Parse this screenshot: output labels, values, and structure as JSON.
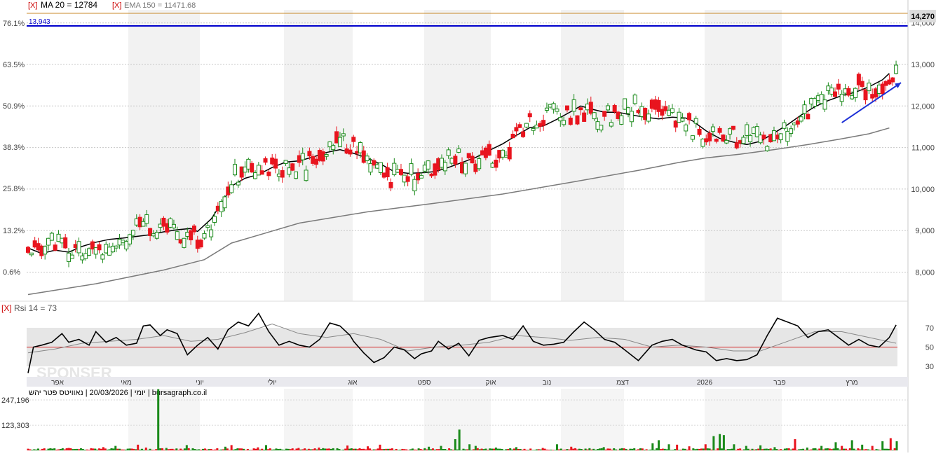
{
  "header": {
    "ma_toggle": "[X]",
    "ma_label": "MA 20 = 12784",
    "ema_toggle": "[X]",
    "ema_label": "EMA 150 = 11471.68",
    "rsi_toggle": "[X]",
    "rsi_label": "Rsi 14 = 73",
    "footer_label": "יומי | 20/03/2026 | נאוויטס פטר יהש | bursagraph.co.il",
    "watermark": "SPONSER"
  },
  "colors": {
    "up": "#1a8a1a",
    "down": "#e8141e",
    "ma": "#000000",
    "ema": "#7a7a7a",
    "resistance": "#0000cc",
    "price_line": "#c88a2a",
    "trend_arrow": "#1c2fd6",
    "band_shade": "#e6e6e6",
    "rsi_mid": "#d42020"
  },
  "chart_data": [
    {
      "type": "candlestick",
      "y_axis_ticks": [
        "14,000",
        "13,000",
        "12,000",
        "11,000",
        "10,000",
        "9,000",
        "8,000"
      ],
      "left_axis_ticks": [
        "76.1%",
        "63.5%",
        "50.9%",
        "38.3%",
        "25.8%",
        "13.2%",
        "0.6%"
      ],
      "last_price_label": "14,270",
      "last_price": 14270,
      "resistance_label": "13,943",
      "resistance": 13943,
      "ylim": [
        7400,
        14400
      ],
      "x_month_labels": [
        "אפר",
        "מאי",
        "יוני",
        "יולי",
        "אוג",
        "ספט",
        "אוק",
        "נוב",
        "דצמ",
        "2026",
        "פבר",
        "מרץ"
      ],
      "series": [
        {
          "name": "MA 20",
          "points": [
            [
              0,
              8580
            ],
            [
              20,
              8450
            ],
            [
              40,
              8530
            ],
            [
              60,
              8480
            ],
            [
              80,
              8620
            ],
            [
              100,
              8720
            ],
            [
              120,
              8790
            ],
            [
              140,
              8820
            ],
            [
              160,
              8860
            ],
            [
              180,
              8900
            ],
            [
              200,
              8970
            ],
            [
              220,
              9020
            ],
            [
              240,
              9050
            ],
            [
              250,
              8980
            ],
            [
              270,
              9280
            ],
            [
              290,
              9780
            ],
            [
              300,
              10070
            ],
            [
              320,
              10260
            ],
            [
              340,
              10350
            ],
            [
              360,
              10520
            ],
            [
              380,
              10650
            ],
            [
              400,
              10680
            ],
            [
              420,
              10770
            ],
            [
              440,
              10880
            ],
            [
              460,
              10950
            ],
            [
              480,
              10860
            ],
            [
              500,
              10750
            ],
            [
              520,
              10600
            ],
            [
              540,
              10420
            ],
            [
              560,
              10380
            ],
            [
              580,
              10390
            ],
            [
              600,
              10420
            ],
            [
              620,
              10520
            ],
            [
              640,
              10640
            ],
            [
              660,
              10760
            ],
            [
              680,
              10930
            ],
            [
              700,
              11090
            ],
            [
              720,
              11290
            ],
            [
              740,
              11480
            ],
            [
              760,
              11520
            ],
            [
              780,
              11680
            ],
            [
              800,
              11860
            ],
            [
              815,
              12000
            ],
            [
              830,
              11930
            ],
            [
              850,
              11850
            ],
            [
              870,
              11850
            ],
            [
              890,
              11780
            ],
            [
              910,
              11730
            ],
            [
              930,
              11690
            ],
            [
              950,
              11730
            ],
            [
              970,
              11710
            ],
            [
              980,
              11640
            ],
            [
              1000,
              11400
            ],
            [
              1020,
              11220
            ],
            [
              1040,
              11130
            ],
            [
              1060,
              11070
            ],
            [
              1080,
              11150
            ],
            [
              1100,
              11350
            ],
            [
              1120,
              11550
            ],
            [
              1140,
              11780
            ],
            [
              1160,
              11980
            ],
            [
              1180,
              12130
            ],
            [
              1200,
              12250
            ],
            [
              1220,
              12330
            ],
            [
              1240,
              12460
            ],
            [
              1260,
              12630
            ],
            [
              1270,
              12784
            ]
          ]
        },
        {
          "name": "EMA 150",
          "points": [
            [
              0,
              7460
            ],
            [
              100,
              7720
            ],
            [
              200,
              8050
            ],
            [
              260,
              8300
            ],
            [
              300,
              8700
            ],
            [
              400,
              9180
            ],
            [
              500,
              9450
            ],
            [
              600,
              9660
            ],
            [
              700,
              9880
            ],
            [
              800,
              10160
            ],
            [
              900,
              10450
            ],
            [
              960,
              10640
            ],
            [
              1000,
              10750
            ],
            [
              1050,
              10840
            ],
            [
              1100,
              10950
            ],
            [
              1150,
              11070
            ],
            [
              1200,
              11210
            ],
            [
              1240,
              11330
            ],
            [
              1270,
              11471
            ]
          ]
        }
      ],
      "trend_arrow": {
        "from": [
          1200,
          11600
        ],
        "to": [
          1280,
          12560
        ]
      }
    },
    {
      "type": "line",
      "title": "Rsi 14 = 73",
      "ylim": [
        20,
        90
      ],
      "y_ticks": [
        70,
        50,
        30
      ],
      "band": [
        30,
        70
      ],
      "midline": 50,
      "series": [
        {
          "name": "Rsi 14",
          "points": [
            [
              0,
              23
            ],
            [
              8,
              50
            ],
            [
              20,
              52
            ],
            [
              35,
              55
            ],
            [
              50,
              64
            ],
            [
              60,
              55
            ],
            [
              75,
              58
            ],
            [
              90,
              52
            ],
            [
              100,
              66
            ],
            [
              115,
              55
            ],
            [
              130,
              60
            ],
            [
              145,
              52
            ],
            [
              160,
              54
            ],
            [
              170,
              72
            ],
            [
              180,
              73
            ],
            [
              195,
              62
            ],
            [
              205,
              68
            ],
            [
              220,
              64
            ],
            [
              235,
              42
            ],
            [
              250,
              52
            ],
            [
              265,
              60
            ],
            [
              280,
              48
            ],
            [
              295,
              68
            ],
            [
              310,
              76
            ],
            [
              325,
              72
            ],
            [
              340,
              85
            ],
            [
              355,
              66
            ],
            [
              370,
              52
            ],
            [
              385,
              56
            ],
            [
              400,
              52
            ],
            [
              415,
              50
            ],
            [
              430,
              58
            ],
            [
              445,
              75
            ],
            [
              460,
              72
            ],
            [
              475,
              62
            ],
            [
              480,
              56
            ],
            [
              495,
              44
            ],
            [
              510,
              34
            ],
            [
              525,
              39
            ],
            [
              540,
              50
            ],
            [
              555,
              47
            ],
            [
              570,
              38
            ],
            [
              580,
              43
            ],
            [
              595,
              46
            ],
            [
              605,
              56
            ],
            [
              620,
              48
            ],
            [
              635,
              54
            ],
            [
              650,
              41
            ],
            [
              665,
              57
            ],
            [
              680,
              60
            ],
            [
              700,
              62
            ],
            [
              715,
              58
            ],
            [
              730,
              72
            ],
            [
              745,
              56
            ],
            [
              760,
              52
            ],
            [
              775,
              53
            ],
            [
              790,
              55
            ],
            [
              805,
              66
            ],
            [
              820,
              76
            ],
            [
              835,
              68
            ],
            [
              850,
              58
            ],
            [
              865,
              55
            ],
            [
              880,
              47
            ],
            [
              900,
              36
            ],
            [
              920,
              52
            ],
            [
              935,
              56
            ],
            [
              950,
              58
            ],
            [
              965,
              52
            ],
            [
              985,
              47
            ],
            [
              1000,
              45
            ],
            [
              1015,
              36
            ],
            [
              1030,
              38
            ],
            [
              1045,
              36
            ],
            [
              1060,
              37
            ],
            [
              1075,
              42
            ],
            [
              1090,
              62
            ],
            [
              1105,
              80
            ],
            [
              1120,
              76
            ],
            [
              1135,
              72
            ],
            [
              1150,
              60
            ],
            [
              1165,
              66
            ],
            [
              1180,
              68
            ],
            [
              1195,
              60
            ],
            [
              1210,
              52
            ],
            [
              1225,
              58
            ],
            [
              1240,
              52
            ],
            [
              1255,
              50
            ],
            [
              1270,
              60
            ],
            [
              1280,
              73
            ]
          ]
        },
        {
          "name": "Rsi MA",
          "points": [
            [
              0,
              44
            ],
            [
              40,
              48
            ],
            [
              80,
              54
            ],
            [
              120,
              56
            ],
            [
              160,
              58
            ],
            [
              200,
              62
            ],
            [
              240,
              56
            ],
            [
              280,
              58
            ],
            [
              320,
              65
            ],
            [
              360,
              74
            ],
            [
              400,
              64
            ],
            [
              440,
              60
            ],
            [
              480,
              64
            ],
            [
              520,
              58
            ],
            [
              560,
              46
            ],
            [
              600,
              50
            ],
            [
              640,
              52
            ],
            [
              680,
              55
            ],
            [
              720,
              62
            ],
            [
              760,
              60
            ],
            [
              800,
              57
            ],
            [
              840,
              60
            ],
            [
              880,
              58
            ],
            [
              920,
              50
            ],
            [
              960,
              52
            ],
            [
              1000,
              50
            ],
            [
              1040,
              46
            ],
            [
              1080,
              46
            ],
            [
              1120,
              56
            ],
            [
              1160,
              66
            ],
            [
              1200,
              66
            ],
            [
              1240,
              60
            ],
            [
              1280,
              54
            ]
          ]
        }
      ]
    },
    {
      "type": "bar",
      "y_ticks": [
        "247,196",
        "123,303"
      ],
      "ylim": [
        0,
        300000
      ],
      "values": [
        [
          60,
          12000
        ],
        [
          110,
          16000
        ],
        [
          130,
          22000
        ],
        [
          150,
          9000
        ],
        [
          163,
          28000
        ],
        [
          175,
          14000
        ],
        [
          192,
          300000
        ],
        [
          205,
          12000
        ],
        [
          235,
          26000
        ],
        [
          260,
          9000
        ],
        [
          290,
          18000
        ],
        [
          300,
          26000
        ],
        [
          340,
          15000
        ],
        [
          352,
          26000
        ],
        [
          400,
          12000
        ],
        [
          430,
          14000
        ],
        [
          470,
          24000
        ],
        [
          500,
          20000
        ],
        [
          520,
          28000
        ],
        [
          590,
          18000
        ],
        [
          610,
          22000
        ],
        [
          630,
          55000
        ],
        [
          636,
          102000
        ],
        [
          650,
          30000
        ],
        [
          660,
          22000
        ],
        [
          690,
          14000
        ],
        [
          720,
          16000
        ],
        [
          760,
          12000
        ],
        [
          780,
          30000
        ],
        [
          800,
          18000
        ],
        [
          850,
          16000
        ],
        [
          880,
          10000
        ],
        [
          920,
          35000
        ],
        [
          930,
          50000
        ],
        [
          945,
          30000
        ],
        [
          958,
          28000
        ],
        [
          975,
          20000
        ],
        [
          1000,
          30000
        ],
        [
          1012,
          70000
        ],
        [
          1019,
          80000
        ],
        [
          1027,
          75000
        ],
        [
          1040,
          30000
        ],
        [
          1060,
          22000
        ],
        [
          1080,
          25000
        ],
        [
          1100,
          16000
        ],
        [
          1130,
          55000
        ],
        [
          1150,
          14000
        ],
        [
          1170,
          22000
        ],
        [
          1190,
          40000
        ],
        [
          1200,
          22000
        ],
        [
          1215,
          50000
        ],
        [
          1230,
          28000
        ],
        [
          1245,
          22000
        ],
        [
          1260,
          45000
        ],
        [
          1272,
          60000
        ],
        [
          1282,
          45000
        ]
      ]
    }
  ]
}
